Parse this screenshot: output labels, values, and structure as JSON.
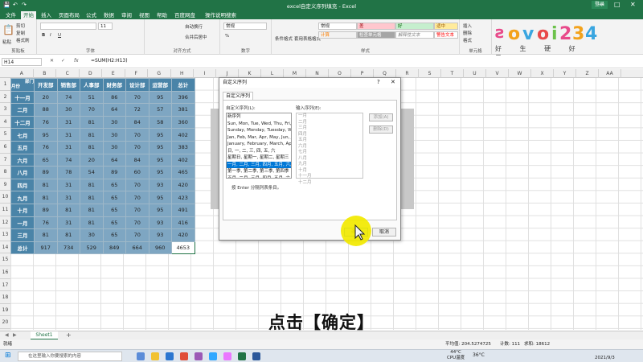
{
  "app": {
    "title": "excel自定义序列填充 - Excel",
    "login": "登录",
    "controls": [
      "—",
      "□",
      "✕"
    ],
    "qat_icons": [
      "save-icon",
      "undo-icon",
      "redo-icon"
    ]
  },
  "tabs": [
    "文件",
    "开始",
    "插入",
    "页面布局",
    "公式",
    "数据",
    "审阅",
    "视图",
    "帮助",
    "百度网盘",
    "操作说明搜索"
  ],
  "ribbon": {
    "groups": [
      "剪贴板",
      "字体",
      "对齐方式",
      "数字",
      "样式",
      "单元格"
    ],
    "clipboard": {
      "cut": "剪切",
      "copy": "复制",
      "painter": "格式刷",
      "paste": "粘贴"
    },
    "font": {
      "name": "",
      "size": "11",
      "bold": "B",
      "italic": "I",
      "underline": "U"
    },
    "align": {
      "wrap": "自动换行",
      "merge": "合并后居中"
    },
    "number": {
      "format": "常规",
      "percent": "%"
    },
    "styles": {
      "cond_format": "条件格式",
      "table_format": "套用表格格式",
      "cells": [
        "常规",
        "差",
        "好",
        "适中",
        "计算",
        "检查单元格",
        "解释性文本",
        "警告文本"
      ]
    },
    "cells": {
      "insert": "插入",
      "delete": "删除",
      "format": "格式"
    },
    "logo_text": "好 生 硬 好 二"
  },
  "formula_bar": {
    "name_box": "H14",
    "formula": "=SUM(H2:H13)",
    "fx": "fx"
  },
  "columns": [
    "A",
    "B",
    "C",
    "D",
    "E",
    "F",
    "G",
    "H",
    "I",
    "J",
    "K",
    "L",
    "M",
    "N",
    "O",
    "P",
    "Q",
    "R",
    "S",
    "T",
    "U",
    "V",
    "W",
    "X",
    "Y",
    "Z",
    "AA"
  ],
  "row_numbers": [
    "1",
    "2",
    "3",
    "4",
    "5",
    "6",
    "7",
    "8",
    "9",
    "10",
    "11",
    "12",
    "13",
    "14",
    "15",
    "16",
    "17",
    "18",
    "19",
    "20",
    "21"
  ],
  "table": {
    "corner_top": "部门",
    "corner_bottom": "月份",
    "headers": [
      "开发部",
      "销售部",
      "人事部",
      "财务部",
      "设计部",
      "运营部",
      "总计"
    ],
    "rows": [
      {
        "label": "十一月",
        "values": [
          "20",
          "74",
          "51",
          "86",
          "70",
          "95",
          "396"
        ]
      },
      {
        "label": "二月",
        "values": [
          "88",
          "30",
          "70",
          "64",
          "72",
          "57",
          "381"
        ]
      },
      {
        "label": "十二月",
        "values": [
          "76",
          "31",
          "81",
          "30",
          "84",
          "58",
          "360"
        ]
      },
      {
        "label": "七月",
        "values": [
          "95",
          "31",
          "81",
          "30",
          "70",
          "95",
          "402"
        ]
      },
      {
        "label": "五月",
        "values": [
          "76",
          "31",
          "81",
          "30",
          "70",
          "95",
          "383"
        ]
      },
      {
        "label": "六月",
        "values": [
          "65",
          "74",
          "20",
          "64",
          "84",
          "95",
          "402"
        ]
      },
      {
        "label": "八月",
        "values": [
          "89",
          "78",
          "54",
          "89",
          "60",
          "95",
          "465"
        ]
      },
      {
        "label": "四月",
        "values": [
          "81",
          "31",
          "81",
          "65",
          "70",
          "93",
          "420"
        ]
      },
      {
        "label": "九月",
        "values": [
          "81",
          "31",
          "81",
          "65",
          "70",
          "95",
          "423"
        ]
      },
      {
        "label": "十月",
        "values": [
          "89",
          "81",
          "81",
          "65",
          "70",
          "95",
          "491"
        ]
      },
      {
        "label": "一月",
        "values": [
          "76",
          "31",
          "81",
          "65",
          "70",
          "93",
          "416"
        ]
      },
      {
        "label": "三月",
        "values": [
          "81",
          "81",
          "30",
          "65",
          "70",
          "93",
          "420"
        ]
      }
    ],
    "total_row": {
      "label": "总计",
      "values": [
        "917",
        "734",
        "529",
        "849",
        "664",
        "960",
        "4653"
      ]
    }
  },
  "dialog": {
    "title": "自定义序列",
    "help": "?",
    "close": "✕",
    "tab": "自定义序列",
    "list_label": "自定义序列(L):",
    "entries_label": "输入序列(E):",
    "list_items": [
      "新序列",
      "Sun, Mon, Tue, Wed, Thu, Fri, S",
      "Sunday, Monday, Tuesday, Wed",
      "Jan, Feb, Mar, Apr, May, Jun, Ju",
      "January, February, March, April",
      "日, 一, 二, 三, 四, 五, 六",
      "星期日, 星期一, 星期二, 星期三",
      "一月, 二月, 三月, 四月, 五月, 六月",
      "第一季, 第二季, 第三季, 第四季",
      "正月, 二月, 三月, 四月, 五月, 六月",
      "子, 丑, 寅, 卯, 辰, 巳, 午, 未, 申",
      "甲, 乙, 丙, 丁, 戊, 己, 庚, 辛, 壬"
    ],
    "selected_index": 7,
    "entries": [
      "一月",
      "二月",
      "三月",
      "四月",
      "五月",
      "六月",
      "七月",
      "八月",
      "九月",
      "十月",
      "十一月",
      "十二月"
    ],
    "add_button": "添加(A)",
    "delete_button": "删除(D)",
    "hint": "按 Enter 分隔列表条目。",
    "ok": "确定",
    "cancel": "取消"
  },
  "subtitle": "点击【确定】",
  "sheet_tab": "Sheet1",
  "add_sheet": "+",
  "status": {
    "ready": "就绪",
    "average": "平均值: 204.5274725",
    "count": "计数: 111",
    "sum": "求和: 18612"
  },
  "taskbar": {
    "search_placeholder": "在这里输入你要搜索的内容",
    "temp": "44°C",
    "cpu": "CPU温度",
    "weather": "36°C",
    "date": "2021/9/3"
  }
}
